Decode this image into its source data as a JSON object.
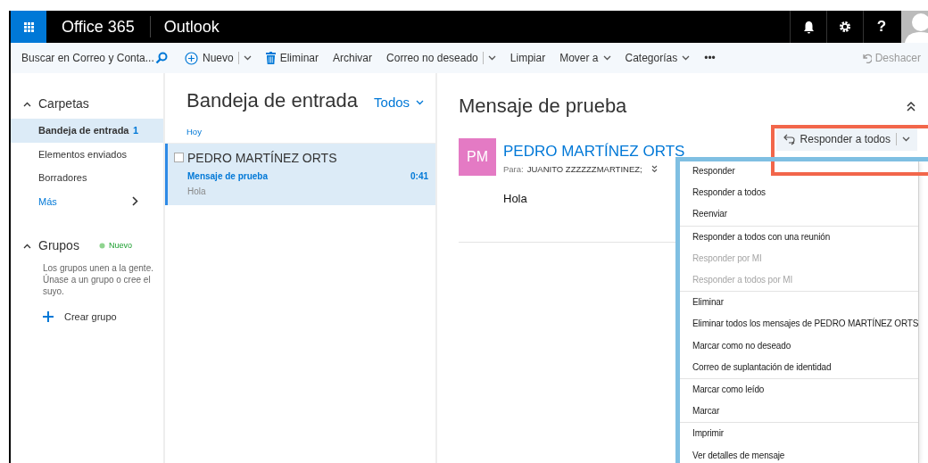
{
  "header": {
    "brand": "Office 365",
    "app": "Outlook",
    "help": "?"
  },
  "search": {
    "placeholder": "Buscar en Correo y Conta..."
  },
  "toolbar": [
    {
      "label": "Nuevo",
      "kind": "new"
    },
    {
      "label": "Eliminar",
      "kind": "delete"
    },
    {
      "label": "Archivar",
      "kind": "plain"
    },
    {
      "label": "Correo no deseado",
      "kind": "split"
    },
    {
      "label": "Limpiar",
      "kind": "plain"
    },
    {
      "label": "Mover a",
      "kind": "menu"
    },
    {
      "label": "Categorías",
      "kind": "menu"
    },
    {
      "label": "•••",
      "kind": "plain"
    }
  ],
  "undo": {
    "label": "Deshacer",
    "disabled": true
  },
  "sidebar": {
    "folders_heading": "Carpetas",
    "expanded": true,
    "folders": [
      {
        "label": "Bandeja de entrada",
        "count": "1",
        "selected": true
      },
      {
        "label": "Elementos enviados",
        "selected": false
      },
      {
        "label": "Borradores",
        "selected": false
      }
    ],
    "more": "Más",
    "groups": {
      "heading": "Grupos",
      "expanded": true,
      "badge": "Nuevo",
      "description": "Los grupos unen a la gente. Únase a un grupo o cree el suyo.",
      "create": "Crear grupo"
    }
  },
  "message_list": {
    "title": "Bandeja de entrada",
    "filter": "Todos",
    "group": "Hoy",
    "messages": [
      {
        "sender": "PEDRO MARTÍNEZ ORTS",
        "subject": "Mensaje de prueba",
        "preview": "Hola",
        "time": "0:41",
        "selected": true,
        "checked": false
      }
    ]
  },
  "reading_pane": {
    "subject": "Mensaje de prueba",
    "initials": "PM",
    "sender": "PEDRO MARTÍNEZ ORTS",
    "to_label": "Para:",
    "to": "JUANITO ZZZZZZMARTINEZ;",
    "body": "Hola",
    "reply_button": "Responder a todos"
  },
  "reply_menu": [
    [
      {
        "label": "Responder",
        "disabled": false
      },
      {
        "label": "Responder a todos",
        "disabled": false
      },
      {
        "label": "Reenviar",
        "disabled": false
      }
    ],
    [
      {
        "label": "Responder a todos con una reunión",
        "disabled": false
      },
      {
        "label": "Responder por MI",
        "disabled": true
      },
      {
        "label": "Responder a todos por MI",
        "disabled": true
      }
    ],
    [
      {
        "label": "Eliminar",
        "disabled": false
      },
      {
        "label": "Eliminar todos los mensajes de PEDRO MARTÍNEZ ORTS",
        "disabled": false
      },
      {
        "label": "Marcar como no deseado",
        "disabled": false
      },
      {
        "label": "Correo de suplantación de identidad",
        "disabled": false
      }
    ],
    [
      {
        "label": "Marcar como leído",
        "disabled": false
      },
      {
        "label": "Marcar",
        "disabled": false
      }
    ],
    [
      {
        "label": "Imprimir",
        "disabled": false
      },
      {
        "label": "Ver detalles de mensaje",
        "disabled": false
      }
    ]
  ],
  "highlights": [
    {
      "kind": "button",
      "color": "#f2664a"
    },
    {
      "kind": "menu",
      "color": "#7fbfe2"
    }
  ]
}
